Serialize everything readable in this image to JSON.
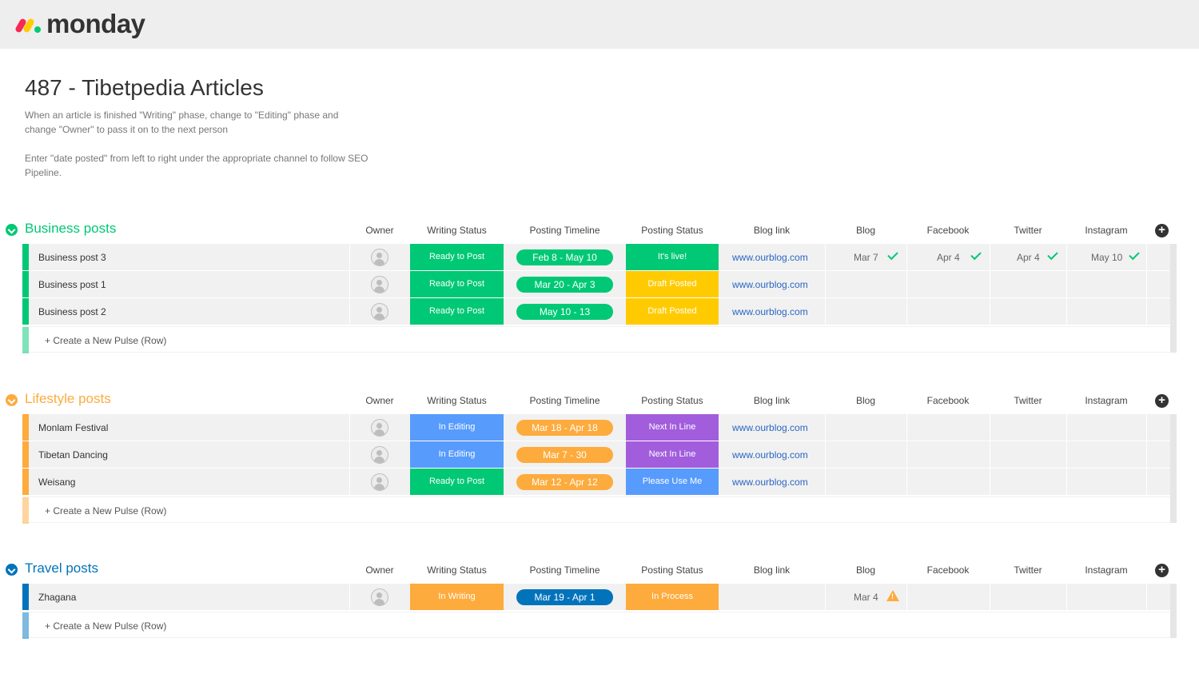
{
  "app": {
    "logo_text": "monday"
  },
  "board": {
    "title": "487 - Tibetpedia Articles",
    "description_1": "When an article is finished \"Writing\" phase, change to \"Editing\" phase and change \"Owner\" to pass it on to the next person",
    "description_2": "Enter \"date posted\" from left to right under the appropriate channel to follow SEO Pipeline."
  },
  "columns": {
    "owner": "Owner",
    "writing_status": "Writing Status",
    "posting_timeline": "Posting Timeline",
    "posting_status": "Posting Status",
    "blog_link": "Blog link",
    "blog": "Blog",
    "facebook": "Facebook",
    "twitter": "Twitter",
    "instagram": "Instagram"
  },
  "create_row_label": "+ Create a New Pulse (Row)",
  "colors": {
    "green_status": "#00c875",
    "orange": "#fdab3d",
    "yellow": "#ffcb00",
    "blue": "#579bfc",
    "purple": "#a25ddc",
    "dark_blue": "#0073bb",
    "group_business": "#00c875",
    "group_lifestyle": "#fdab3d",
    "group_travel": "#0073bb"
  },
  "groups": [
    {
      "title": "Business posts",
      "color": "#00c875",
      "rows": [
        {
          "name": "Business post 3",
          "writing_status": "Ready to Post",
          "writing_color": "#00c875",
          "timeline": "Feb 8 - May 10",
          "timeline_color": "#00c875",
          "posting_status": "It's live!",
          "posting_color": "#00c875",
          "blog_link": "www.ourblog.com",
          "blog": "Mar 7",
          "facebook": "Apr 4",
          "twitter": "Apr 4",
          "instagram": "May 10"
        },
        {
          "name": "Business post 1",
          "writing_status": "Ready to Post",
          "writing_color": "#00c875",
          "timeline": "Mar 20 - Apr 3",
          "timeline_color": "#00c875",
          "posting_status": "Draft Posted",
          "posting_color": "#ffcb00",
          "blog_link": "www.ourblog.com",
          "blog": "",
          "facebook": "",
          "twitter": "",
          "instagram": ""
        },
        {
          "name": "Business post 2",
          "writing_status": "Ready to Post",
          "writing_color": "#00c875",
          "timeline": "May 10 - 13",
          "timeline_color": "#00c875",
          "posting_status": "Draft Posted",
          "posting_color": "#ffcb00",
          "blog_link": "www.ourblog.com",
          "blog": "",
          "facebook": "",
          "twitter": "",
          "instagram": ""
        }
      ]
    },
    {
      "title": "Lifestyle posts",
      "color": "#fdab3d",
      "rows": [
        {
          "name": "Monlam Festival",
          "writing_status": "In Editing",
          "writing_color": "#579bfc",
          "timeline": "Mar 18 - Apr 18",
          "timeline_color": "#fdab3d",
          "posting_status": "Next In Line",
          "posting_color": "#a25ddc",
          "blog_link": "www.ourblog.com"
        },
        {
          "name": "Tibetan Dancing",
          "writing_status": "In Editing",
          "writing_color": "#579bfc",
          "timeline": "Mar 7 - 30",
          "timeline_color": "#fdab3d",
          "posting_status": "Next In Line",
          "posting_color": "#a25ddc",
          "blog_link": "www.ourblog.com"
        },
        {
          "name": "Weisang",
          "writing_status": "Ready to Post",
          "writing_color": "#00c875",
          "timeline": "Mar 12 - Apr 12",
          "timeline_color": "#fdab3d",
          "posting_status": "Please Use Me",
          "posting_color": "#579bfc",
          "blog_link": "www.ourblog.com"
        }
      ]
    },
    {
      "title": "Travel posts",
      "color": "#0073bb",
      "rows": [
        {
          "name": "Zhagana",
          "writing_status": "In Writing",
          "writing_color": "#fdab3d",
          "timeline": "Mar 19 - Apr 1",
          "timeline_color": "#0073bb",
          "posting_status": "In Process",
          "posting_color": "#fdab3d",
          "blog_link": "",
          "blog": "Mar 4"
        }
      ]
    }
  ]
}
